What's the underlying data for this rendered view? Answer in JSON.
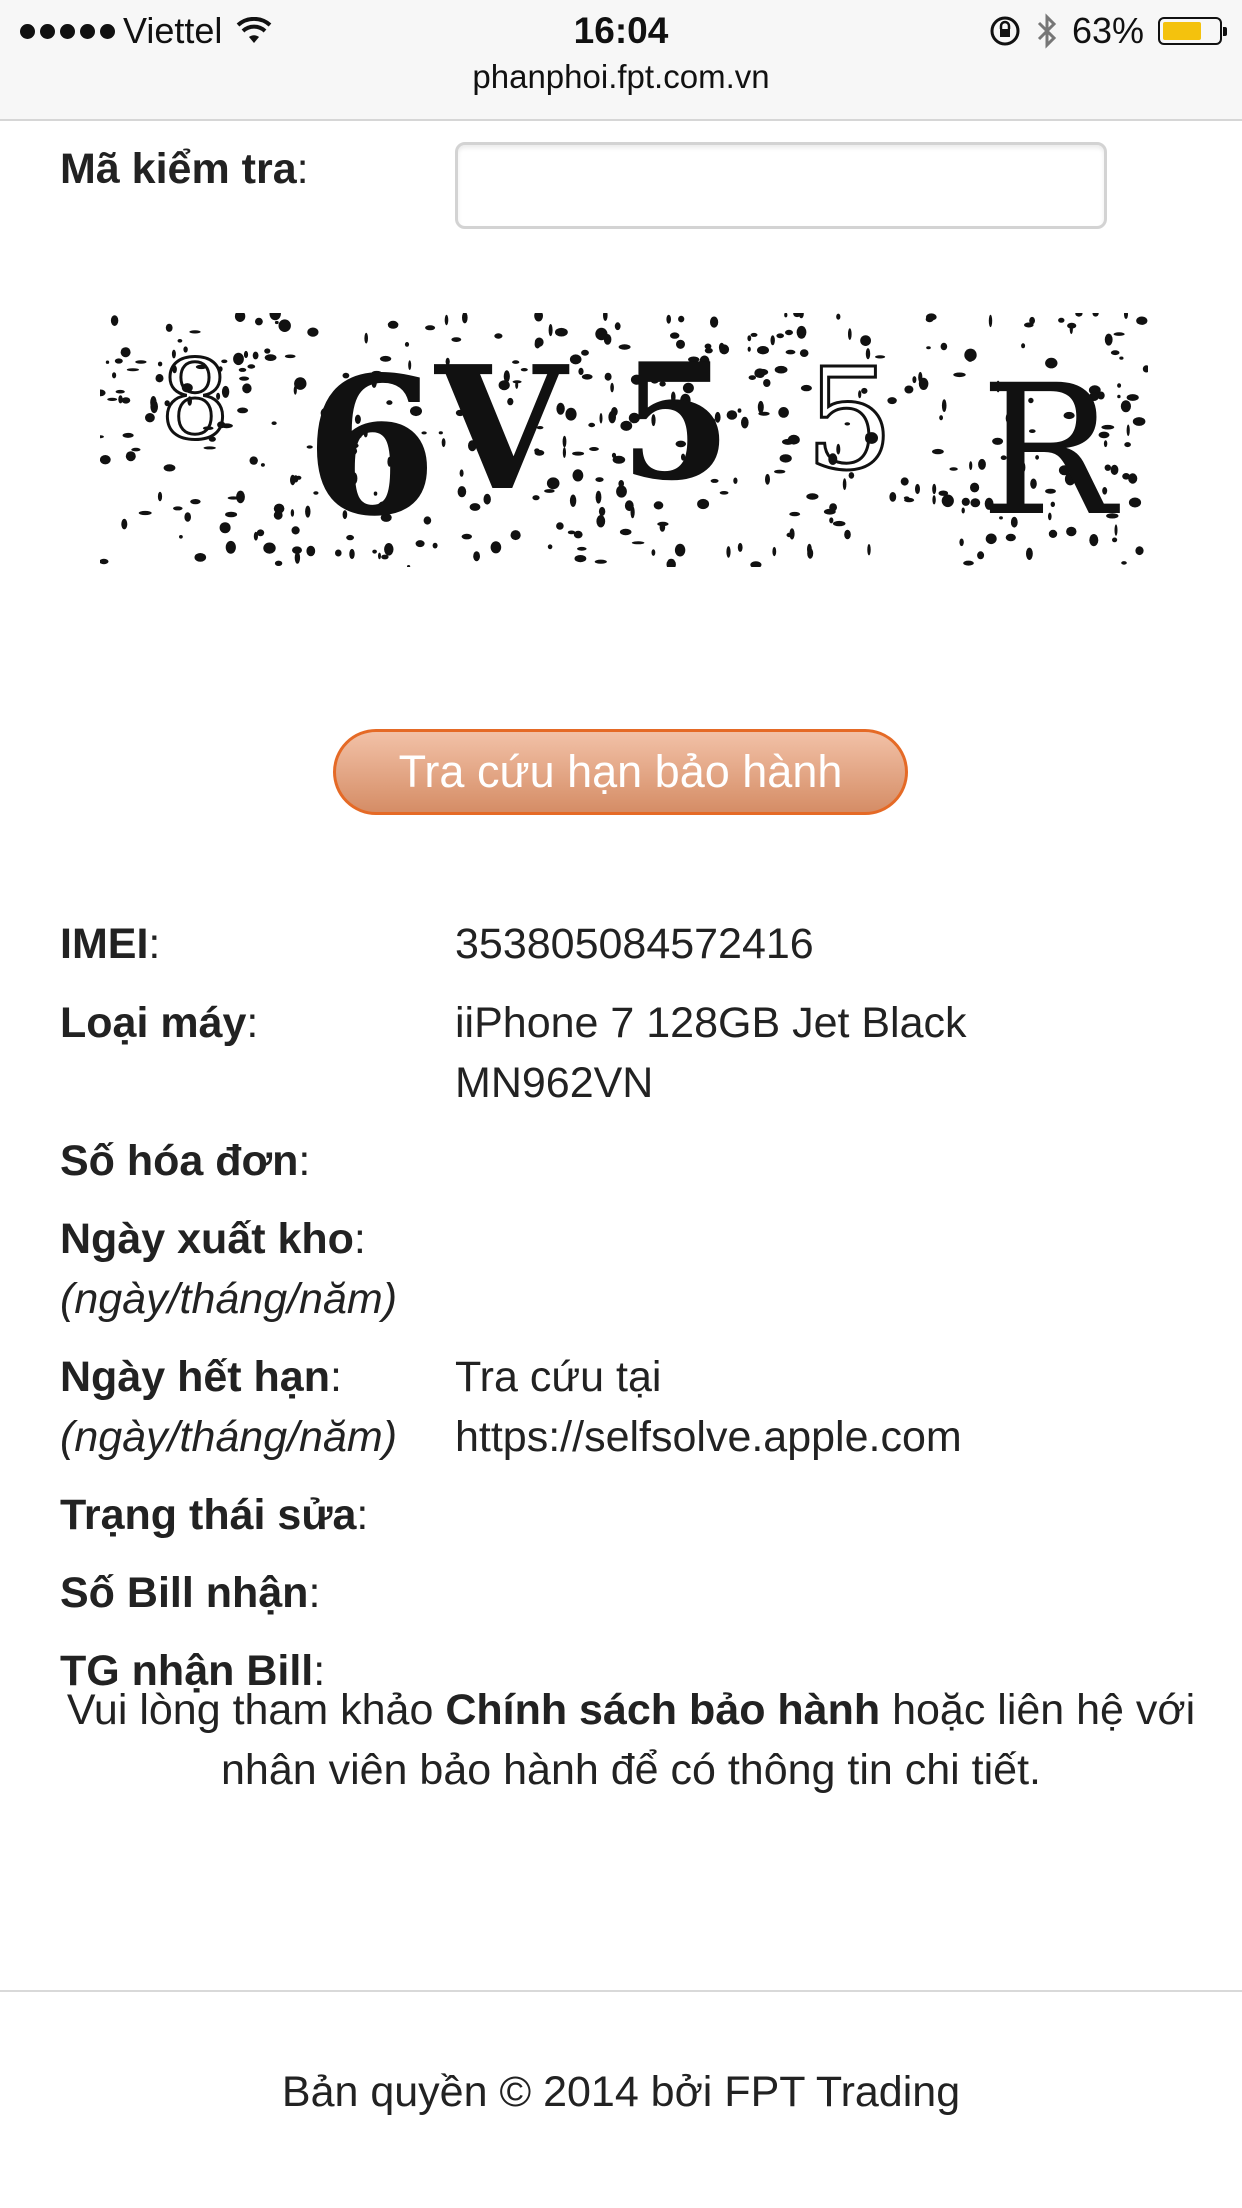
{
  "status_bar": {
    "carrier": "Viettel",
    "time": "16:04",
    "battery_percent": "63%",
    "battery_level": 0.63,
    "icons": [
      "signal-dots-icon",
      "wifi-icon",
      "orientation-lock-icon",
      "bluetooth-icon",
      "battery-icon"
    ]
  },
  "browser": {
    "url": "phanphoi.fpt.com.vn"
  },
  "form": {
    "captcha_label": "Mã kiểm tra",
    "captcha_input_value": "",
    "captcha_chars": [
      "8",
      "6",
      "V",
      "5",
      "5",
      "R"
    ],
    "submit_label": "Tra cứu hạn bảo hành"
  },
  "result": {
    "imei_label": "IMEI",
    "imei_value": "353805084572416",
    "model_label": "Loại máy",
    "model_value_line1": "iiPhone 7 128GB Jet Black",
    "model_value_line2": "MN962VN",
    "invoice_label": "Số hóa đơn",
    "ship_date_label": "Ngày xuất kho",
    "ship_date_hint": "(ngày/tháng/năm)",
    "expiry_label": "Ngày hết hạn",
    "expiry_hint": "(ngày/tháng/năm)",
    "expiry_value_line1": "Tra cứu tại",
    "expiry_value_line2": "https://selfsolve.apple.com",
    "repair_status_label": "Trạng thái sửa",
    "bill_no_label": "Số Bill nhận",
    "bill_time_label": "TG nhận Bill",
    "colon": ":"
  },
  "note": {
    "prefix": "Vui lòng tham khảo ",
    "link": "Chính sách bảo hành",
    "suffix": " hoặc liên hệ với nhân viên bảo hành để có thông tin chi tiết."
  },
  "footer": {
    "text": "Bản quyền © 2014 bởi FPT Trading"
  },
  "colors": {
    "button_border": "#e56a26",
    "button_fill_top": "#f2c1a7",
    "button_fill_bottom": "#d58d66",
    "battery": "#f4c20d"
  }
}
